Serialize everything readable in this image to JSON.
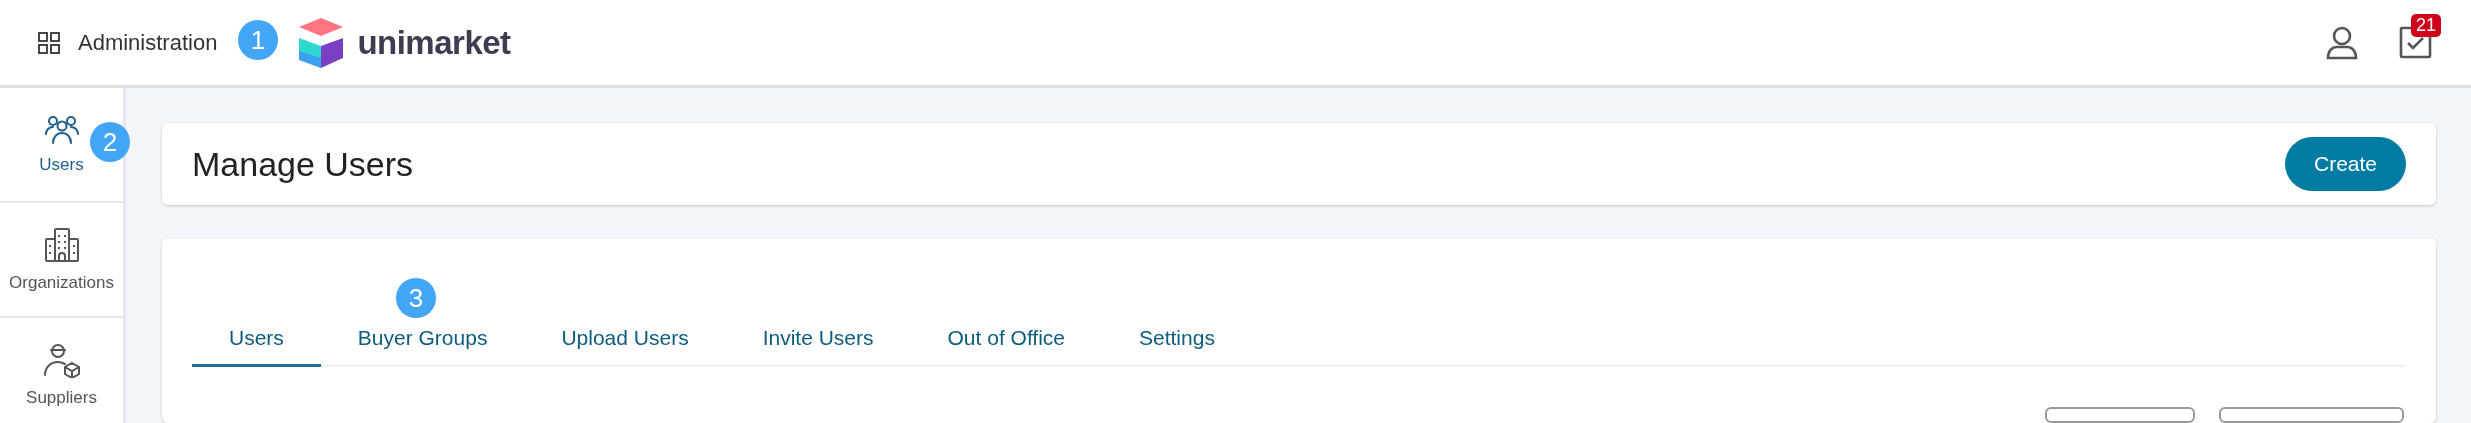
{
  "header": {
    "app_name": "Administration",
    "brand": "unimarket",
    "tasks_badge": "21"
  },
  "sidebar": {
    "items": [
      {
        "label": "Users",
        "selected": true
      },
      {
        "label": "Organizations",
        "selected": false
      },
      {
        "label": "Suppliers",
        "selected": false
      }
    ]
  },
  "page": {
    "title": "Manage Users",
    "create_button": "Create"
  },
  "tabs": [
    {
      "label": "Users",
      "selected": true
    },
    {
      "label": "Buyer Groups",
      "selected": false
    },
    {
      "label": "Upload Users",
      "selected": false
    },
    {
      "label": "Invite Users",
      "selected": false
    },
    {
      "label": "Out of Office",
      "selected": false
    },
    {
      "label": "Settings",
      "selected": false
    }
  ],
  "annotations": [
    {
      "label": "1"
    },
    {
      "label": "2"
    },
    {
      "label": "3"
    }
  ]
}
